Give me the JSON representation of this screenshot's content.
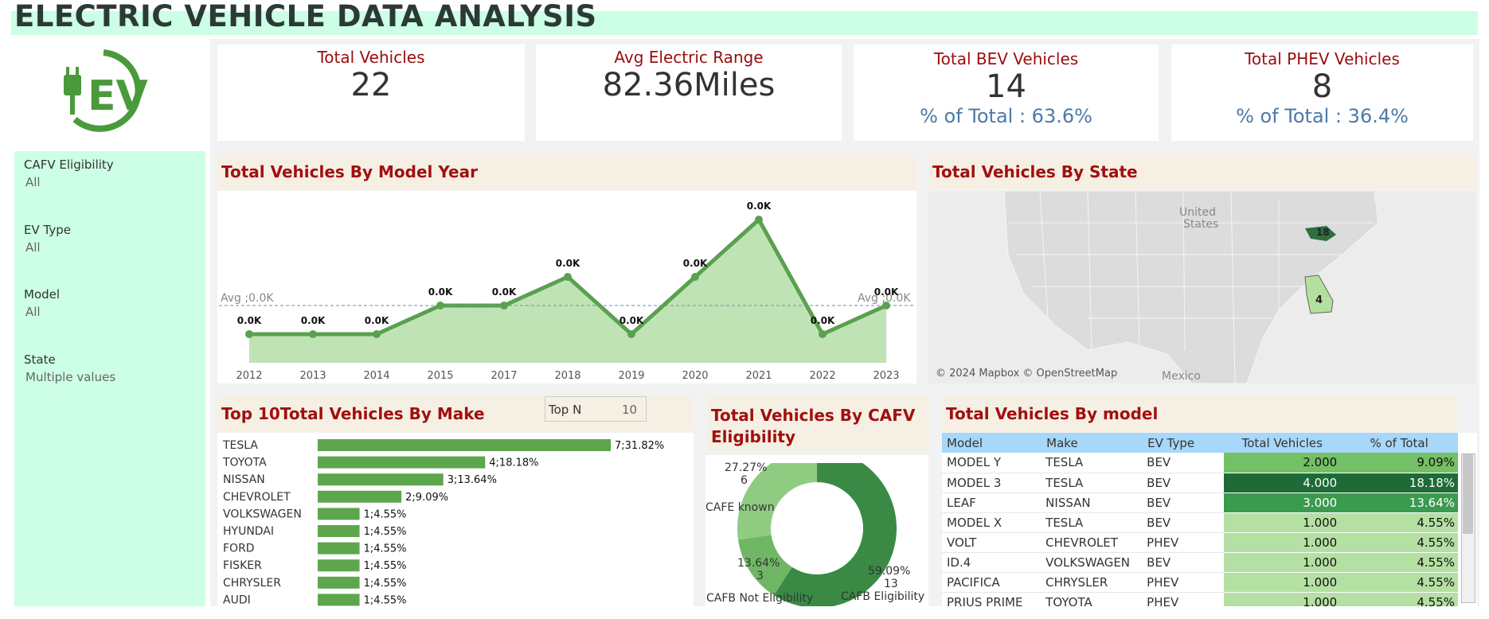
{
  "dashboard": {
    "title": "ELECTRIC VEHICLE DATA ANALYSIS",
    "logo_text": "EV"
  },
  "colors": {
    "title_bg": "#ccffe5",
    "header_bg": "#f6efe3",
    "header_text": "#a01010",
    "bar_green": "#5ea64d",
    "line_green": "#59a14f",
    "area_green": "#b9e0ad",
    "table_header": "#a7d7f9"
  },
  "kpis": {
    "total_vehicles": {
      "label": "Total Vehicles",
      "value": "22"
    },
    "avg_range": {
      "label": "Avg Electric Range",
      "value": "82.36Miles"
    },
    "bev": {
      "label": "Total BEV Vehicles",
      "value": "14",
      "sub": "% of Total : 63.6%"
    },
    "phev": {
      "label": "Total PHEV Vehicles",
      "value": "8",
      "sub": "% of Total : 36.4%"
    }
  },
  "filters": [
    {
      "label": "CAFV Eligibility",
      "value": "All"
    },
    {
      "label": "EV Type",
      "value": "All"
    },
    {
      "label": "Model",
      "value": "All"
    },
    {
      "label": "State",
      "value": "Multiple values"
    }
  ],
  "year_chart": {
    "title": "Total Vehicles By Model Year",
    "avg_label_left": "Avg ;0.0K",
    "avg_label_right": "Avg ;0.0K",
    "avg_value": 2,
    "chart_data": {
      "type": "area",
      "categories": [
        "2012",
        "2013",
        "2014",
        "2015",
        "2017",
        "2018",
        "2019",
        "2020",
        "2021",
        "2022",
        "2023"
      ],
      "values": [
        1,
        1,
        1,
        2,
        2,
        3,
        1,
        3,
        5,
        1,
        2
      ],
      "data_labels": [
        "0.0K",
        "0.0K",
        "0.0K",
        "0.0K",
        "0.0K",
        "0.0K",
        "0.0K",
        "0.0K",
        "0.0K",
        "0.0K",
        "0.0K"
      ],
      "ylim": [
        0,
        5
      ]
    }
  },
  "state_map": {
    "title": "Total Vehicles By State",
    "country_label_1": "United",
    "country_label_2": "States",
    "mexico_label": "Mexico",
    "attribution": "© 2024 Mapbox © OpenStreetMap",
    "states": [
      {
        "name": "Maryland",
        "value": "18"
      },
      {
        "name": "Georgia",
        "value": "4"
      }
    ]
  },
  "make_chart": {
    "title": "Top 10Total Vehicles By Make",
    "topn_label": "Top N",
    "topn_value": "10",
    "chart_data": {
      "type": "bar",
      "categories": [
        "TESLA",
        "TOYOTA",
        "NISSAN",
        "CHEVROLET",
        "VOLKSWAGEN",
        "HYUNDAI",
        "FORD",
        "FISKER",
        "CHRYSLER",
        "AUDI"
      ],
      "values": [
        7,
        4,
        3,
        2,
        1,
        1,
        1,
        1,
        1,
        1
      ],
      "labels": [
        "7;31.82%",
        "4;18.18%",
        "3;13.64%",
        "2;9.09%",
        "1;4.55%",
        "1;4.55%",
        "1;4.55%",
        "1;4.55%",
        "1;4.55%",
        "1;4.55%"
      ]
    }
  },
  "cafv_chart": {
    "title_line1": "Total Vehicles By CAFV",
    "title_line2": "Eligibility",
    "chart_data": {
      "type": "pie",
      "slices": [
        {
          "name": "CAFB Eligibility",
          "value": 13,
          "pct": "59.09%",
          "count": "13",
          "color": "#3a8a45"
        },
        {
          "name": "CAFB Not Eligibility",
          "value": 3,
          "pct": "13.64%",
          "count": "3",
          "color": "#6fb765"
        },
        {
          "name": "CAFE known",
          "value": 6,
          "pct": "27.27%",
          "count": "6",
          "color": "#8fcc82"
        }
      ]
    }
  },
  "model_table": {
    "title": "Total Vehicles By model",
    "columns": [
      "Model",
      "Make",
      "EV Type",
      "Total Vehicles",
      "% of Total"
    ],
    "rows": [
      {
        "model": "MODEL Y",
        "make": "TESLA",
        "type": "BEV",
        "total": "2.000",
        "pct": "9.09%",
        "shade": "#74c066",
        "light": false
      },
      {
        "model": "MODEL 3",
        "make": "TESLA",
        "type": "BEV",
        "total": "4.000",
        "pct": "18.18%",
        "shade": "#1e6b38",
        "light": true
      },
      {
        "model": "LEAF",
        "make": "NISSAN",
        "type": "BEV",
        "total": "3.000",
        "pct": "13.64%",
        "shade": "#3a9a4e",
        "light": true
      },
      {
        "model": "MODEL X",
        "make": "TESLA",
        "type": "BEV",
        "total": "1.000",
        "pct": "4.55%",
        "shade": "#b5e0a3",
        "light": false
      },
      {
        "model": "VOLT",
        "make": "CHEVROLET",
        "type": "PHEV",
        "total": "1.000",
        "pct": "4.55%",
        "shade": "#b5e0a3",
        "light": false
      },
      {
        "model": "ID.4",
        "make": "VOLKSWAGEN",
        "type": "BEV",
        "total": "1.000",
        "pct": "4.55%",
        "shade": "#b5e0a3",
        "light": false
      },
      {
        "model": "PACIFICA",
        "make": "CHRYSLER",
        "type": "PHEV",
        "total": "1.000",
        "pct": "4.55%",
        "shade": "#b5e0a3",
        "light": false
      },
      {
        "model": "PRIUS PRIME",
        "make": "TOYOTA",
        "type": "PHEV",
        "total": "1.000",
        "pct": "4.55%",
        "shade": "#b5e0a3",
        "light": false
      }
    ]
  }
}
